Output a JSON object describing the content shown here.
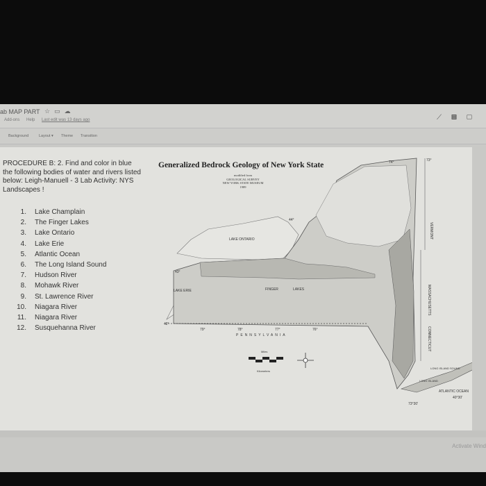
{
  "app": {
    "doc_title": "ab MAP PART",
    "menus": [
      "Add-ons",
      "Help"
    ],
    "last_edit": "Last edit was 13 days ago",
    "toolbar": [
      "Background",
      "Layout ▾",
      "Theme",
      "Transition"
    ],
    "title_icons": [
      "star-icon",
      "folder-icon",
      "cloud-icon"
    ],
    "right_icons": [
      "activity-icon",
      "comment-icon",
      "present-icon"
    ]
  },
  "slide": {
    "procedure": "PROCEDURE B: 2. Find and color in blue the following bodies of water and rivers listed below: Leigh-Manuell - 3 Lab Activity: NYS Landscapes !",
    "items": [
      {
        "num": "1.",
        "label": "Lake Champlain"
      },
      {
        "num": "2.",
        "label": "The Finger Lakes"
      },
      {
        "num": "3.",
        "label": "Lake Ontario"
      },
      {
        "num": "4.",
        "label": "Lake Erie"
      },
      {
        "num": "5.",
        "label": "Atlantic Ocean"
      },
      {
        "num": "6.",
        "label": "The Long Island Sound"
      },
      {
        "num": "7.",
        "label": "Hudson River"
      },
      {
        "num": "8.",
        "label": "Mohawk River"
      },
      {
        "num": "9.",
        "label": "St. Lawrence River"
      },
      {
        "num": "10.",
        "label": "Niagara River"
      },
      {
        "num": "11.",
        "label": "Niagara River"
      },
      {
        "num": "12.",
        "label": "Susquehanna River"
      }
    ],
    "map": {
      "title": "Generalized Bedrock Geology of New York State",
      "credit": [
        "modified from",
        "GEOLOGICAL SURVEY",
        "NEW YORK STATE MUSEUM",
        "1989"
      ],
      "labels": {
        "lake_ontario": "LAKE ONTARIO",
        "lake_erie": "LAKE ERIE",
        "finger": "FINGER",
        "lakes": "LAKES",
        "pennsylvania": "PENNSYLVANIA",
        "vermont": "VERMONT",
        "massachusetts": "MASSACHUSETTS",
        "connecticut": "CONNECTICUT",
        "atlantic": "ATLANTIC OCEAN",
        "li_sound": "LONG ISLAND SOUND",
        "long_island": "LONG ISLAND",
        "miles": "Miles",
        "kilometers": "Kilometers",
        "lat43": "43°",
        "lat42": "42°",
        "lat44": "44°",
        "lon79": "79°",
        "lon78": "78°",
        "lon77": "77°",
        "lon76": "76°",
        "lon74": "74°",
        "lon73": "73°",
        "lon7330": "73°30'",
        "lat4030": "40°30'"
      }
    }
  },
  "watermark": "Activate Wind"
}
